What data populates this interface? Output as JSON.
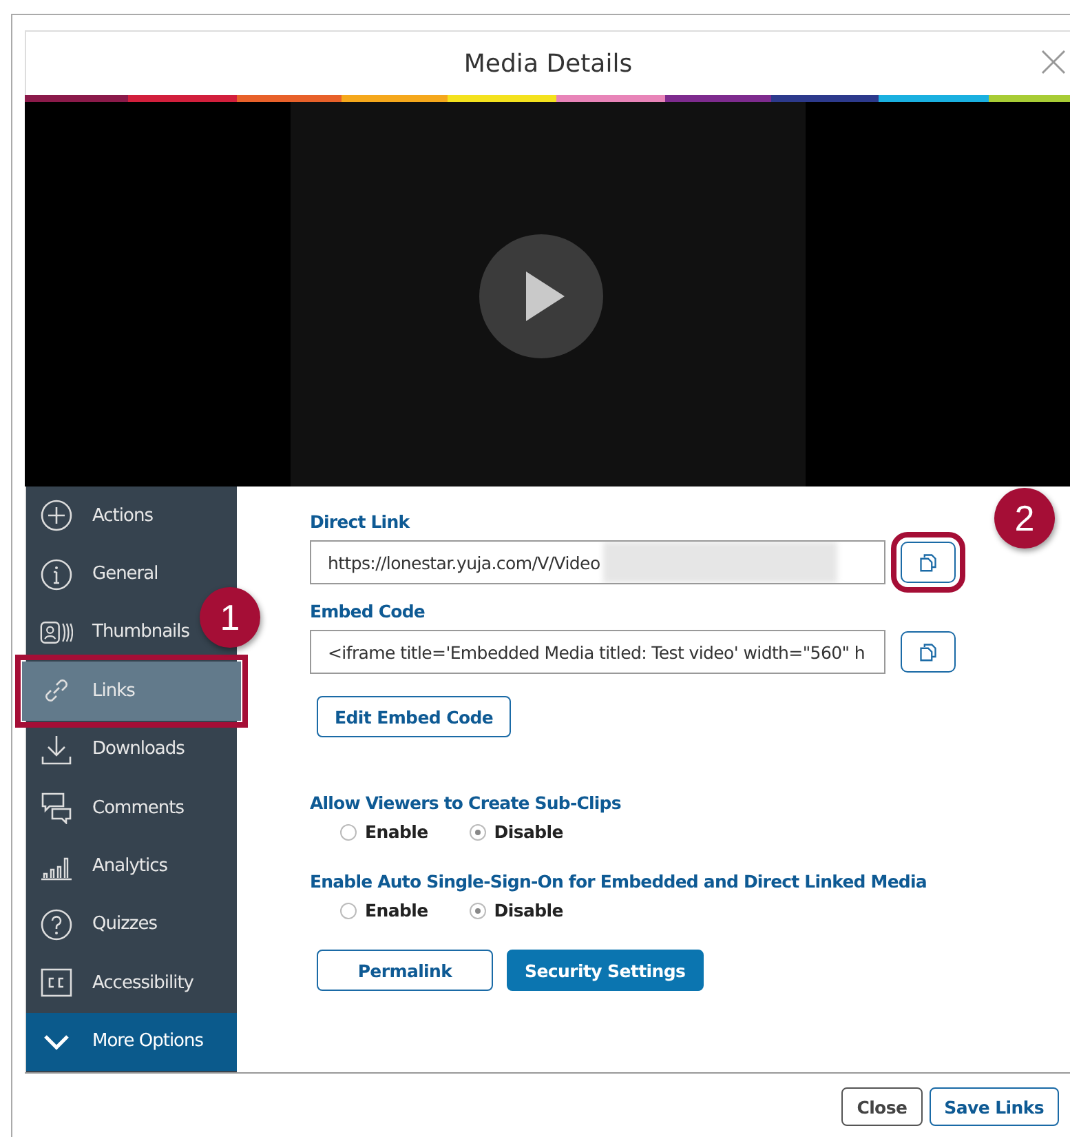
{
  "dialog": {
    "title": "Media Details"
  },
  "sidebar": {
    "items": [
      {
        "kind": "nav",
        "label": "Actions",
        "selected": false
      },
      {
        "kind": "nav",
        "label": "General",
        "selected": false
      },
      {
        "kind": "nav",
        "label": "Thumbnails",
        "selected": false
      },
      {
        "kind": "nav",
        "label": "Links",
        "selected": true,
        "callout": "1"
      },
      {
        "kind": "nav",
        "label": "Downloads",
        "selected": false
      },
      {
        "kind": "nav",
        "label": "Comments",
        "selected": false
      },
      {
        "kind": "nav",
        "label": "Analytics",
        "selected": false
      },
      {
        "kind": "nav",
        "label": "Quizzes",
        "selected": false
      },
      {
        "kind": "nav",
        "label": "Accessibility",
        "selected": false
      },
      {
        "kind": "more",
        "label": "More Options",
        "selected": false
      }
    ]
  },
  "direct_link": {
    "label": "Direct Link",
    "value": "https://lonestar.yuja.com/V/Video",
    "callout": "2"
  },
  "embed_code": {
    "label": "Embed Code",
    "value": "<iframe title='Embedded Media titled: Test video' width=\"560\"  h"
  },
  "edit_embed_button": "Edit Embed Code",
  "radio_groups": [
    {
      "label": "Allow Viewers to Create Sub-Clips",
      "options": [
        {
          "label": "Enable",
          "selected": false
        },
        {
          "label": "Disable",
          "selected": true
        }
      ]
    },
    {
      "label": "Enable Auto Single-Sign-On for Embedded and Direct Linked Media",
      "options": [
        {
          "label": "Enable",
          "selected": false
        },
        {
          "label": "Disable",
          "selected": true
        }
      ]
    }
  ],
  "action_buttons": [
    {
      "label": "Permalink",
      "kind": "outline"
    },
    {
      "label": "Security Settings",
      "kind": "primary"
    }
  ],
  "footer_buttons": [
    {
      "label": "Close",
      "kind": "neutral"
    },
    {
      "label": "Save Links",
      "kind": "outline"
    }
  ]
}
